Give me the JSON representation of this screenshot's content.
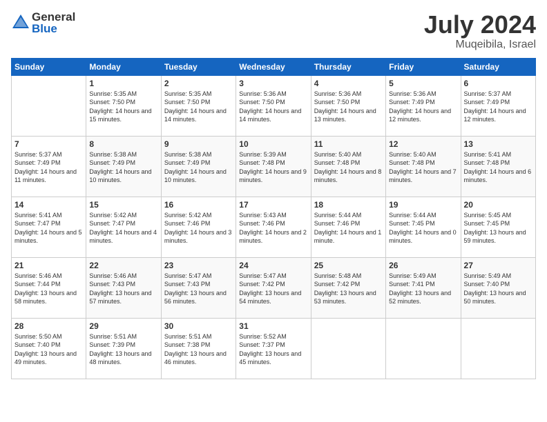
{
  "logo": {
    "general": "General",
    "blue": "Blue"
  },
  "title": {
    "month": "July 2024",
    "location": "Muqeibila, Israel"
  },
  "headers": [
    "Sunday",
    "Monday",
    "Tuesday",
    "Wednesday",
    "Thursday",
    "Friday",
    "Saturday"
  ],
  "weeks": [
    [
      {
        "day": "",
        "sunrise": "",
        "sunset": "",
        "daylight": ""
      },
      {
        "day": "1",
        "sunrise": "Sunrise: 5:35 AM",
        "sunset": "Sunset: 7:50 PM",
        "daylight": "Daylight: 14 hours and 15 minutes."
      },
      {
        "day": "2",
        "sunrise": "Sunrise: 5:35 AM",
        "sunset": "Sunset: 7:50 PM",
        "daylight": "Daylight: 14 hours and 14 minutes."
      },
      {
        "day": "3",
        "sunrise": "Sunrise: 5:36 AM",
        "sunset": "Sunset: 7:50 PM",
        "daylight": "Daylight: 14 hours and 14 minutes."
      },
      {
        "day": "4",
        "sunrise": "Sunrise: 5:36 AM",
        "sunset": "Sunset: 7:50 PM",
        "daylight": "Daylight: 14 hours and 13 minutes."
      },
      {
        "day": "5",
        "sunrise": "Sunrise: 5:36 AM",
        "sunset": "Sunset: 7:49 PM",
        "daylight": "Daylight: 14 hours and 12 minutes."
      },
      {
        "day": "6",
        "sunrise": "Sunrise: 5:37 AM",
        "sunset": "Sunset: 7:49 PM",
        "daylight": "Daylight: 14 hours and 12 minutes."
      }
    ],
    [
      {
        "day": "7",
        "sunrise": "Sunrise: 5:37 AM",
        "sunset": "Sunset: 7:49 PM",
        "daylight": "Daylight: 14 hours and 11 minutes."
      },
      {
        "day": "8",
        "sunrise": "Sunrise: 5:38 AM",
        "sunset": "Sunset: 7:49 PM",
        "daylight": "Daylight: 14 hours and 10 minutes."
      },
      {
        "day": "9",
        "sunrise": "Sunrise: 5:38 AM",
        "sunset": "Sunset: 7:49 PM",
        "daylight": "Daylight: 14 hours and 10 minutes."
      },
      {
        "day": "10",
        "sunrise": "Sunrise: 5:39 AM",
        "sunset": "Sunset: 7:48 PM",
        "daylight": "Daylight: 14 hours and 9 minutes."
      },
      {
        "day": "11",
        "sunrise": "Sunrise: 5:40 AM",
        "sunset": "Sunset: 7:48 PM",
        "daylight": "Daylight: 14 hours and 8 minutes."
      },
      {
        "day": "12",
        "sunrise": "Sunrise: 5:40 AM",
        "sunset": "Sunset: 7:48 PM",
        "daylight": "Daylight: 14 hours and 7 minutes."
      },
      {
        "day": "13",
        "sunrise": "Sunrise: 5:41 AM",
        "sunset": "Sunset: 7:48 PM",
        "daylight": "Daylight: 14 hours and 6 minutes."
      }
    ],
    [
      {
        "day": "14",
        "sunrise": "Sunrise: 5:41 AM",
        "sunset": "Sunset: 7:47 PM",
        "daylight": "Daylight: 14 hours and 5 minutes."
      },
      {
        "day": "15",
        "sunrise": "Sunrise: 5:42 AM",
        "sunset": "Sunset: 7:47 PM",
        "daylight": "Daylight: 14 hours and 4 minutes."
      },
      {
        "day": "16",
        "sunrise": "Sunrise: 5:42 AM",
        "sunset": "Sunset: 7:46 PM",
        "daylight": "Daylight: 14 hours and 3 minutes."
      },
      {
        "day": "17",
        "sunrise": "Sunrise: 5:43 AM",
        "sunset": "Sunset: 7:46 PM",
        "daylight": "Daylight: 14 hours and 2 minutes."
      },
      {
        "day": "18",
        "sunrise": "Sunrise: 5:44 AM",
        "sunset": "Sunset: 7:46 PM",
        "daylight": "Daylight: 14 hours and 1 minute."
      },
      {
        "day": "19",
        "sunrise": "Sunrise: 5:44 AM",
        "sunset": "Sunset: 7:45 PM",
        "daylight": "Daylight: 14 hours and 0 minutes."
      },
      {
        "day": "20",
        "sunrise": "Sunrise: 5:45 AM",
        "sunset": "Sunset: 7:45 PM",
        "daylight": "Daylight: 13 hours and 59 minutes."
      }
    ],
    [
      {
        "day": "21",
        "sunrise": "Sunrise: 5:46 AM",
        "sunset": "Sunset: 7:44 PM",
        "daylight": "Daylight: 13 hours and 58 minutes."
      },
      {
        "day": "22",
        "sunrise": "Sunrise: 5:46 AM",
        "sunset": "Sunset: 7:43 PM",
        "daylight": "Daylight: 13 hours and 57 minutes."
      },
      {
        "day": "23",
        "sunrise": "Sunrise: 5:47 AM",
        "sunset": "Sunset: 7:43 PM",
        "daylight": "Daylight: 13 hours and 56 minutes."
      },
      {
        "day": "24",
        "sunrise": "Sunrise: 5:47 AM",
        "sunset": "Sunset: 7:42 PM",
        "daylight": "Daylight: 13 hours and 54 minutes."
      },
      {
        "day": "25",
        "sunrise": "Sunrise: 5:48 AM",
        "sunset": "Sunset: 7:42 PM",
        "daylight": "Daylight: 13 hours and 53 minutes."
      },
      {
        "day": "26",
        "sunrise": "Sunrise: 5:49 AM",
        "sunset": "Sunset: 7:41 PM",
        "daylight": "Daylight: 13 hours and 52 minutes."
      },
      {
        "day": "27",
        "sunrise": "Sunrise: 5:49 AM",
        "sunset": "Sunset: 7:40 PM",
        "daylight": "Daylight: 13 hours and 50 minutes."
      }
    ],
    [
      {
        "day": "28",
        "sunrise": "Sunrise: 5:50 AM",
        "sunset": "Sunset: 7:40 PM",
        "daylight": "Daylight: 13 hours and 49 minutes."
      },
      {
        "day": "29",
        "sunrise": "Sunrise: 5:51 AM",
        "sunset": "Sunset: 7:39 PM",
        "daylight": "Daylight: 13 hours and 48 minutes."
      },
      {
        "day": "30",
        "sunrise": "Sunrise: 5:51 AM",
        "sunset": "Sunset: 7:38 PM",
        "daylight": "Daylight: 13 hours and 46 minutes."
      },
      {
        "day": "31",
        "sunrise": "Sunrise: 5:52 AM",
        "sunset": "Sunset: 7:37 PM",
        "daylight": "Daylight: 13 hours and 45 minutes."
      },
      {
        "day": "",
        "sunrise": "",
        "sunset": "",
        "daylight": ""
      },
      {
        "day": "",
        "sunrise": "",
        "sunset": "",
        "daylight": ""
      },
      {
        "day": "",
        "sunrise": "",
        "sunset": "",
        "daylight": ""
      }
    ]
  ]
}
